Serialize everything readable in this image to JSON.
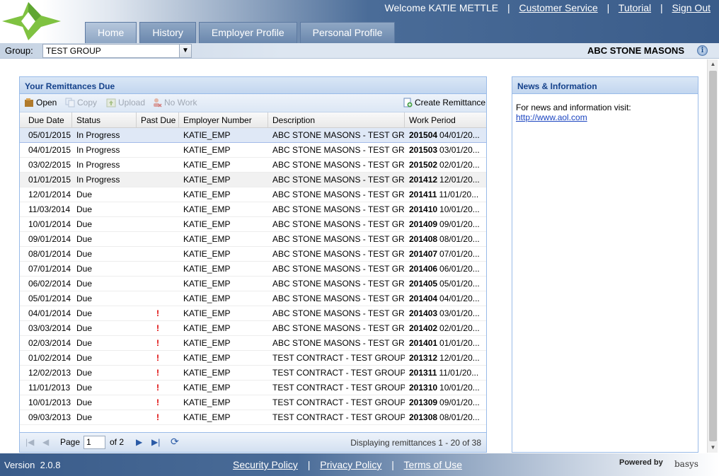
{
  "header": {
    "welcome": "Welcome KATIE METTLE",
    "links": [
      "Customer Service",
      "Tutorial",
      "Sign Out"
    ],
    "tabs": [
      "Home",
      "History",
      "Employer Profile",
      "Personal Profile"
    ],
    "active_tab": "Home"
  },
  "groupbar": {
    "label": "Group:",
    "selected": "TEST GROUP",
    "company": "ABC STONE MASONS",
    "info_icon": "info-icon"
  },
  "remittances": {
    "title": "Your Remittances Due",
    "toolbar": {
      "open": "Open",
      "copy": "Copy",
      "upload": "Upload",
      "nowork": "No Work",
      "create": "Create Remittance"
    },
    "columns": [
      "Due Date",
      "Status",
      "Past Due",
      "Employer Number",
      "Description",
      "Work Period"
    ],
    "rows": [
      {
        "due": "05/01/2015",
        "status": "In Progress",
        "past": "",
        "emp": "KATIE_EMP",
        "desc": "ABC STONE MASONS - TEST GROUP",
        "period": "201504",
        "date": "04/01/20..."
      },
      {
        "due": "04/01/2015",
        "status": "In Progress",
        "past": "",
        "emp": "KATIE_EMP",
        "desc": "ABC STONE MASONS - TEST GROUP",
        "period": "201503",
        "date": "03/01/20..."
      },
      {
        "due": "03/02/2015",
        "status": "In Progress",
        "past": "",
        "emp": "KATIE_EMP",
        "desc": "ABC STONE MASONS - TEST GROUP",
        "period": "201502",
        "date": "02/01/20..."
      },
      {
        "due": "01/01/2015",
        "status": "In Progress",
        "past": "",
        "emp": "KATIE_EMP",
        "desc": "ABC STONE MASONS - TEST GROUP",
        "period": "201412",
        "date": "12/01/20..."
      },
      {
        "due": "12/01/2014",
        "status": "Due",
        "past": "",
        "emp": "KATIE_EMP",
        "desc": "ABC STONE MASONS - TEST GROUP",
        "period": "201411",
        "date": "11/01/20..."
      },
      {
        "due": "11/03/2014",
        "status": "Due",
        "past": "",
        "emp": "KATIE_EMP",
        "desc": "ABC STONE MASONS - TEST GROUP",
        "period": "201410",
        "date": "10/01/20..."
      },
      {
        "due": "10/01/2014",
        "status": "Due",
        "past": "",
        "emp": "KATIE_EMP",
        "desc": "ABC STONE MASONS - TEST GROUP",
        "period": "201409",
        "date": "09/01/20..."
      },
      {
        "due": "09/01/2014",
        "status": "Due",
        "past": "",
        "emp": "KATIE_EMP",
        "desc": "ABC STONE MASONS - TEST GROUP",
        "period": "201408",
        "date": "08/01/20..."
      },
      {
        "due": "08/01/2014",
        "status": "Due",
        "past": "",
        "emp": "KATIE_EMP",
        "desc": "ABC STONE MASONS - TEST GROUP",
        "period": "201407",
        "date": "07/01/20..."
      },
      {
        "due": "07/01/2014",
        "status": "Due",
        "past": "",
        "emp": "KATIE_EMP",
        "desc": "ABC STONE MASONS - TEST GROUP",
        "period": "201406",
        "date": "06/01/20..."
      },
      {
        "due": "06/02/2014",
        "status": "Due",
        "past": "",
        "emp": "KATIE_EMP",
        "desc": "ABC STONE MASONS - TEST GROUP",
        "period": "201405",
        "date": "05/01/20..."
      },
      {
        "due": "05/01/2014",
        "status": "Due",
        "past": "",
        "emp": "KATIE_EMP",
        "desc": "ABC STONE MASONS - TEST GROUP",
        "period": "201404",
        "date": "04/01/20..."
      },
      {
        "due": "04/01/2014",
        "status": "Due",
        "past": "!",
        "emp": "KATIE_EMP",
        "desc": "ABC STONE MASONS - TEST GROUP",
        "period": "201403",
        "date": "03/01/20..."
      },
      {
        "due": "03/03/2014",
        "status": "Due",
        "past": "!",
        "emp": "KATIE_EMP",
        "desc": "ABC STONE MASONS - TEST GROUP",
        "period": "201402",
        "date": "02/01/20..."
      },
      {
        "due": "02/03/2014",
        "status": "Due",
        "past": "!",
        "emp": "KATIE_EMP",
        "desc": "ABC STONE MASONS - TEST GROUP",
        "period": "201401",
        "date": "01/01/20..."
      },
      {
        "due": "01/02/2014",
        "status": "Due",
        "past": "!",
        "emp": "KATIE_EMP",
        "desc": "TEST CONTRACT - TEST GROUP",
        "period": "201312",
        "date": "12/01/20..."
      },
      {
        "due": "12/02/2013",
        "status": "Due",
        "past": "!",
        "emp": "KATIE_EMP",
        "desc": "TEST CONTRACT - TEST GROUP",
        "period": "201311",
        "date": "11/01/20..."
      },
      {
        "due": "11/01/2013",
        "status": "Due",
        "past": "!",
        "emp": "KATIE_EMP",
        "desc": "TEST CONTRACT - TEST GROUP",
        "period": "201310",
        "date": "10/01/20..."
      },
      {
        "due": "10/01/2013",
        "status": "Due",
        "past": "!",
        "emp": "KATIE_EMP",
        "desc": "TEST CONTRACT - TEST GROUP",
        "period": "201309",
        "date": "09/01/20..."
      },
      {
        "due": "09/03/2013",
        "status": "Due",
        "past": "!",
        "emp": "KATIE_EMP",
        "desc": "TEST CONTRACT - TEST GROUP",
        "period": "201308",
        "date": "08/01/20..."
      }
    ],
    "pager": {
      "page_label": "Page",
      "page": "1",
      "of": "of 2",
      "info": "Displaying remittances 1 - 20 of 38"
    }
  },
  "news": {
    "title": "News & Information",
    "text": "For news and information visit:",
    "link": "http://www.aol.com"
  },
  "footer": {
    "version": "Version  2.0.8",
    "links": [
      "Security Policy",
      "Privacy Policy",
      "Terms of Use"
    ],
    "powered": "Powered by",
    "brand": "basys"
  },
  "colors": {
    "header_blue": "#3a5c8a",
    "panel_border": "#99bbe8",
    "panel_title": "#15428b",
    "past_due": "#dd0000"
  }
}
